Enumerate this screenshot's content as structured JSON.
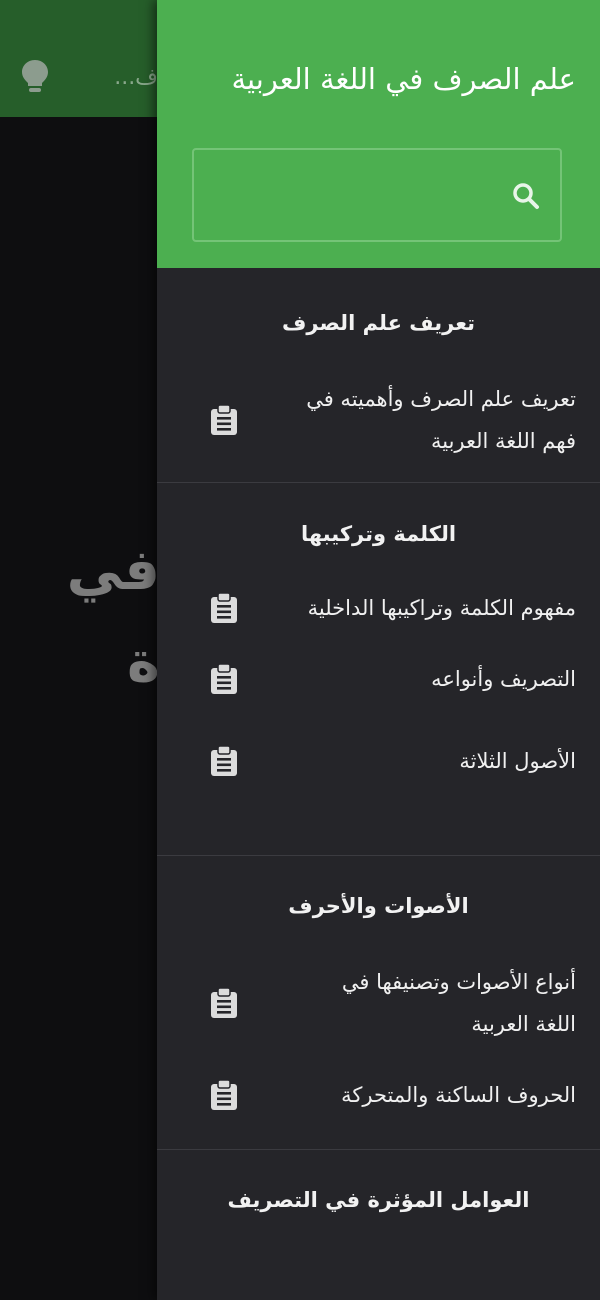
{
  "background": {
    "header_title": "ف...",
    "icon": "lightbulb-icon",
    "big_text_line1": "في",
    "big_text_line2": "ة"
  },
  "drawer": {
    "title": "علم الصرف في اللغة العربية",
    "search": {
      "placeholder": "",
      "value": "",
      "icon": "search-icon"
    },
    "sections": [
      {
        "title": "تعريف علم الصرف",
        "items": [
          {
            "label": "تعريف علم الصرف وأهميته في فهم اللغة العربية",
            "icon": "clipboard-icon"
          }
        ]
      },
      {
        "title": "الكلمة وتركيبها",
        "items": [
          {
            "label": "مفهوم الكلمة وتراكيبها الداخلية",
            "icon": "clipboard-icon"
          },
          {
            "label": "التصريف وأنواعه",
            "icon": "clipboard-icon"
          },
          {
            "label": "الأصول الثلاثة",
            "icon": "clipboard-icon"
          }
        ]
      },
      {
        "title": "الأصوات والأحرف",
        "items": [
          {
            "label": "أنواع الأصوات وتصنيفها في اللغة العربية",
            "icon": "clipboard-icon"
          },
          {
            "label": "الحروف الساكنة والمتحركة",
            "icon": "clipboard-icon"
          }
        ]
      },
      {
        "title": "العوامل المؤثرة في التصريف",
        "items": []
      }
    ]
  },
  "colors": {
    "accent_green": "#4caf50",
    "dark_green": "#265e2a",
    "drawer_bg": "#252529",
    "page_bg": "#0e0e10"
  }
}
